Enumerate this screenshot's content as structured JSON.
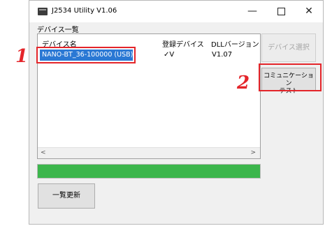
{
  "window": {
    "title": "J2534 Utility V1.06",
    "controls": {
      "minimize": "—",
      "maximize": "",
      "close": "✕"
    }
  },
  "device_list": {
    "section_label": "デバイス一覧",
    "columns": [
      "デバイス名",
      "登録デバイス",
      "DLLバージョン"
    ],
    "rows": [
      {
        "name": "NANO-BT_36-100000 (USB)",
        "registered": "✓V",
        "dll_version": "V1.07"
      }
    ],
    "scroll_left": "<",
    "scroll_right": ">"
  },
  "progress": {
    "value": 1.0,
    "color": "#3cb64c"
  },
  "buttons": {
    "device_select": "デバイス選択",
    "comm_test_line1": "コミュニケーション",
    "comm_test_line2": "テスト",
    "refresh": "一覧更新"
  },
  "callouts": {
    "one": "1",
    "two": "2",
    "color": "#e4252a"
  }
}
